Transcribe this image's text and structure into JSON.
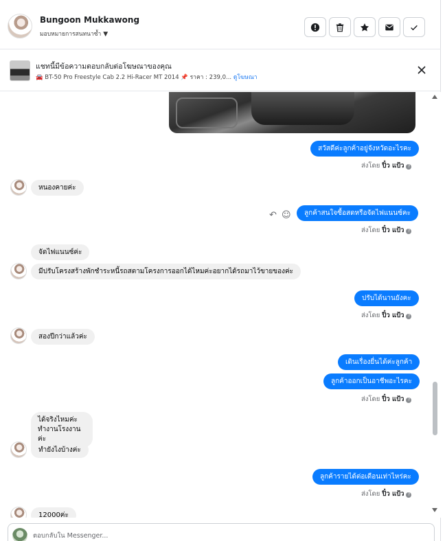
{
  "header": {
    "name": "Bungoon Mukkawong",
    "subtitle": "มอบหมายการสนทนาซ้ำ",
    "actions": [
      {
        "name": "report",
        "icon": "alert-circle-icon"
      },
      {
        "name": "delete",
        "icon": "trash-icon"
      },
      {
        "name": "star",
        "icon": "star-icon"
      },
      {
        "name": "mark-unread",
        "icon": "envelope-icon"
      },
      {
        "name": "done",
        "icon": "check-icon"
      }
    ]
  },
  "ad": {
    "title": "แชทนี้มีข้อความตอบกลับต่อโฆษณาของคุณ",
    "product": "BT-50 Pro Freestyle Cab 2.2 Hi-Racer MT 2014",
    "price": "ราคา : 239,0...",
    "link": "ดูโฆษณา"
  },
  "messages": [
    {
      "dir": "out",
      "text": "สวัสดีค่ะลูกค้าอยู่จังหวัดอะไรคะ"
    },
    {
      "dir": "meta",
      "prefix": "ส่งโดย",
      "sender": "ปิ๋ว แป้ว"
    },
    {
      "dir": "in",
      "text": "หนองคายค่ะ"
    },
    {
      "dir": "out",
      "text": "ลูกค้าสนใจซื้อสดหรือจัดไฟแนนซ์คะ"
    },
    {
      "dir": "meta",
      "prefix": "ส่งโดย",
      "sender": "ปิ๋ว แป้ว"
    },
    {
      "dir": "in",
      "text": "จัดไฟแนนซ์ค่ะ"
    },
    {
      "dir": "in",
      "text": "มีปรับโครงสร้างพักชำระหนี้รถสตามโครงการออกได้ไหมค่ะอยากได้รถมาไว้ขายของค่ะ"
    },
    {
      "dir": "out",
      "text": "ปรับได้นานยังคะ"
    },
    {
      "dir": "meta",
      "prefix": "ส่งโดย",
      "sender": "ปิ๋ว แป้ว"
    },
    {
      "dir": "in",
      "text": "สองปีกว่าแล้วค่ะ"
    },
    {
      "dir": "out",
      "text": "เดินเรื่องยื่นได้ค่ะลูกค้า"
    },
    {
      "dir": "out",
      "text": "ลูกค้าออกเป็นอาชีพอะไรคะ"
    },
    {
      "dir": "meta",
      "prefix": "ส่งโดย",
      "sender": "ปิ๋ว แป้ว"
    },
    {
      "dir": "in",
      "text": "ได้จริงไหมค่ะ"
    },
    {
      "dir": "in",
      "text": "ทำงานโรงงานค่ะ"
    },
    {
      "dir": "in",
      "text": "ทำยังไงบ้างค่ะ"
    },
    {
      "dir": "out",
      "text": "ลูกค้ารายได้ต่อเดือนเท่าไหร่คะ"
    },
    {
      "dir": "meta",
      "prefix": "ส่งโดย",
      "sender": "ปิ๋ว แป้ว"
    },
    {
      "dir": "in",
      "text": "12000ค่ะ"
    }
  ],
  "composer": {
    "placeholder": "ตอบกลับใน Messenger..."
  }
}
